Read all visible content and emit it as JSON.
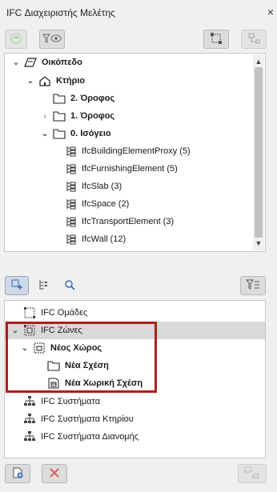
{
  "window": {
    "title": "IFC Διαχειριστής Μελέτης",
    "close_glyph": "×"
  },
  "top_tree": [
    {
      "label": "Οικόπεδο",
      "bold": true,
      "expanded": true,
      "icon": "site-icon"
    },
    {
      "label": "Κτήριο",
      "bold": true,
      "expanded": true,
      "icon": "building-icon"
    },
    {
      "label": "2. Όροφος",
      "bold": true,
      "icon": "folder-icon"
    },
    {
      "label": "1. Όροφος",
      "bold": true,
      "collapsed": true,
      "icon": "folder-icon"
    },
    {
      "label": "0. Ισόγειο",
      "bold": true,
      "expanded": true,
      "icon": "folder-icon"
    },
    {
      "label": "IfcBuildingElementProxy (5)",
      "icon": "element-list-icon"
    },
    {
      "label": "IfcFurnishingElement (5)",
      "icon": "element-list-icon"
    },
    {
      "label": "IfcSlab (3)",
      "icon": "element-list-icon"
    },
    {
      "label": "IfcSpace (2)",
      "icon": "element-list-icon"
    },
    {
      "label": "IfcTransportElement (3)",
      "icon": "element-list-icon"
    },
    {
      "label": "IfcWall (12)",
      "icon": "element-list-icon"
    }
  ],
  "bottom_tree": [
    {
      "label": "IFC Ομάδες",
      "icon": "groups-icon"
    },
    {
      "label": "IFC Ζώνες",
      "icon": "zones-icon",
      "expanded": true,
      "selected": true
    },
    {
      "label": "Νέος Χώρος",
      "bold": true,
      "icon": "zone-icon",
      "expanded": true
    },
    {
      "label": "Νέα Σχέση",
      "bold": true,
      "icon": "folder-icon"
    },
    {
      "label": "Νέα Χωρική Σχέση",
      "bold": true,
      "icon": "spatial-relation-icon"
    },
    {
      "label": "IFC Συστήματα",
      "icon": "systems-icon"
    },
    {
      "label": "IFC Συστήματα Κτηρίου",
      "icon": "systems-icon"
    },
    {
      "label": "IFC Συστήματα Διανομής",
      "icon": "systems-icon"
    }
  ],
  "colors": {
    "highlight_box": "#b01c1c",
    "selected_row": "#d9d9d9"
  }
}
